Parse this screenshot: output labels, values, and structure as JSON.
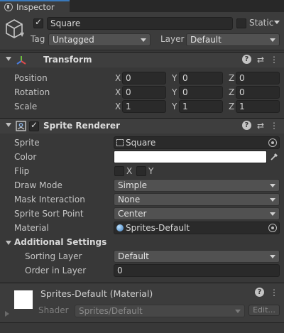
{
  "tab": {
    "label": "Inspector"
  },
  "gameobject": {
    "active": true,
    "name": "Square",
    "static_label": "Static",
    "static_checked": false,
    "tag_label": "Tag",
    "tag_value": "Untagged",
    "layer_label": "Layer",
    "layer_value": "Default"
  },
  "transform": {
    "title": "Transform",
    "rows": [
      {
        "label": "Position",
        "x": "0",
        "y": "0",
        "z": "0"
      },
      {
        "label": "Rotation",
        "x": "0",
        "y": "0",
        "z": "0"
      },
      {
        "label": "Scale",
        "x": "1",
        "y": "1",
        "z": "1"
      }
    ],
    "axis_labels": {
      "x": "X",
      "y": "Y",
      "z": "Z"
    }
  },
  "sprite_renderer": {
    "title": "Sprite Renderer",
    "enabled": true,
    "sprite_label": "Sprite",
    "sprite_value": "Square",
    "color_label": "Color",
    "color_value": "#ffffff",
    "flip_label": "Flip",
    "flip_x": "X",
    "flip_y": "Y",
    "draw_mode_label": "Draw Mode",
    "draw_mode_value": "Simple",
    "mask_label": "Mask Interaction",
    "mask_value": "None",
    "sort_point_label": "Sprite Sort Point",
    "sort_point_value": "Center",
    "material_label": "Material",
    "material_value": "Sprites-Default",
    "additional_label": "Additional Settings",
    "sorting_layer_label": "Sorting Layer",
    "sorting_layer_value": "Default",
    "order_label": "Order in Layer",
    "order_value": "0"
  },
  "material": {
    "title": "Sprites-Default (Material)",
    "shader_label": "Shader",
    "shader_value": "Sprites/Default",
    "edit_label": "Edit..."
  },
  "colors": {
    "background": "#383838",
    "header": "#3e3e3e",
    "field": "#2a2a2a",
    "accent": "#3a79bb"
  }
}
